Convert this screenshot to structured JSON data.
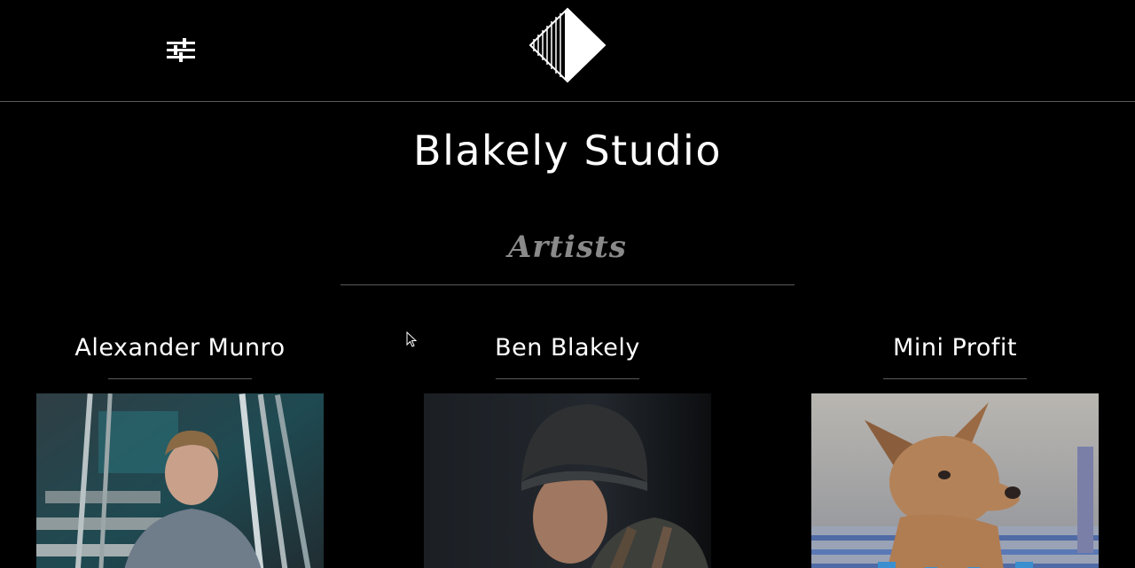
{
  "site_title": "Blakely Studio",
  "section_title": "Artists",
  "artists": [
    {
      "name": "Alexander Munro"
    },
    {
      "name": "Ben Blakely"
    },
    {
      "name": "Mini Profit"
    }
  ]
}
